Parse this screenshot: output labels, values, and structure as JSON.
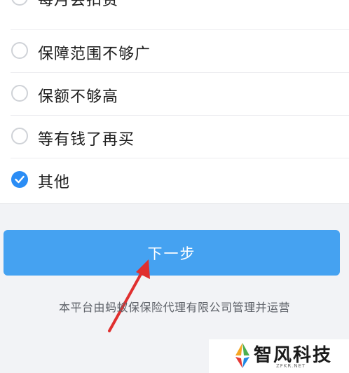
{
  "options": [
    {
      "label": "每月会扣费",
      "checked": false
    },
    {
      "label": "保障范围不够广",
      "checked": false
    },
    {
      "label": "保额不够高",
      "checked": false
    },
    {
      "label": "等有钱了再买",
      "checked": false
    },
    {
      "label": "其他",
      "checked": true
    }
  ],
  "next_button_label": "下一步",
  "footer_text": "本平台由蚂蚁保保险代理有限公司管理并运营",
  "watermark": {
    "name": "智风科技",
    "site": "ZFKR.NET"
  },
  "colors": {
    "accent": "#2b8df5",
    "button": "#45a2f1",
    "annotation_arrow": "#e02f2f"
  }
}
